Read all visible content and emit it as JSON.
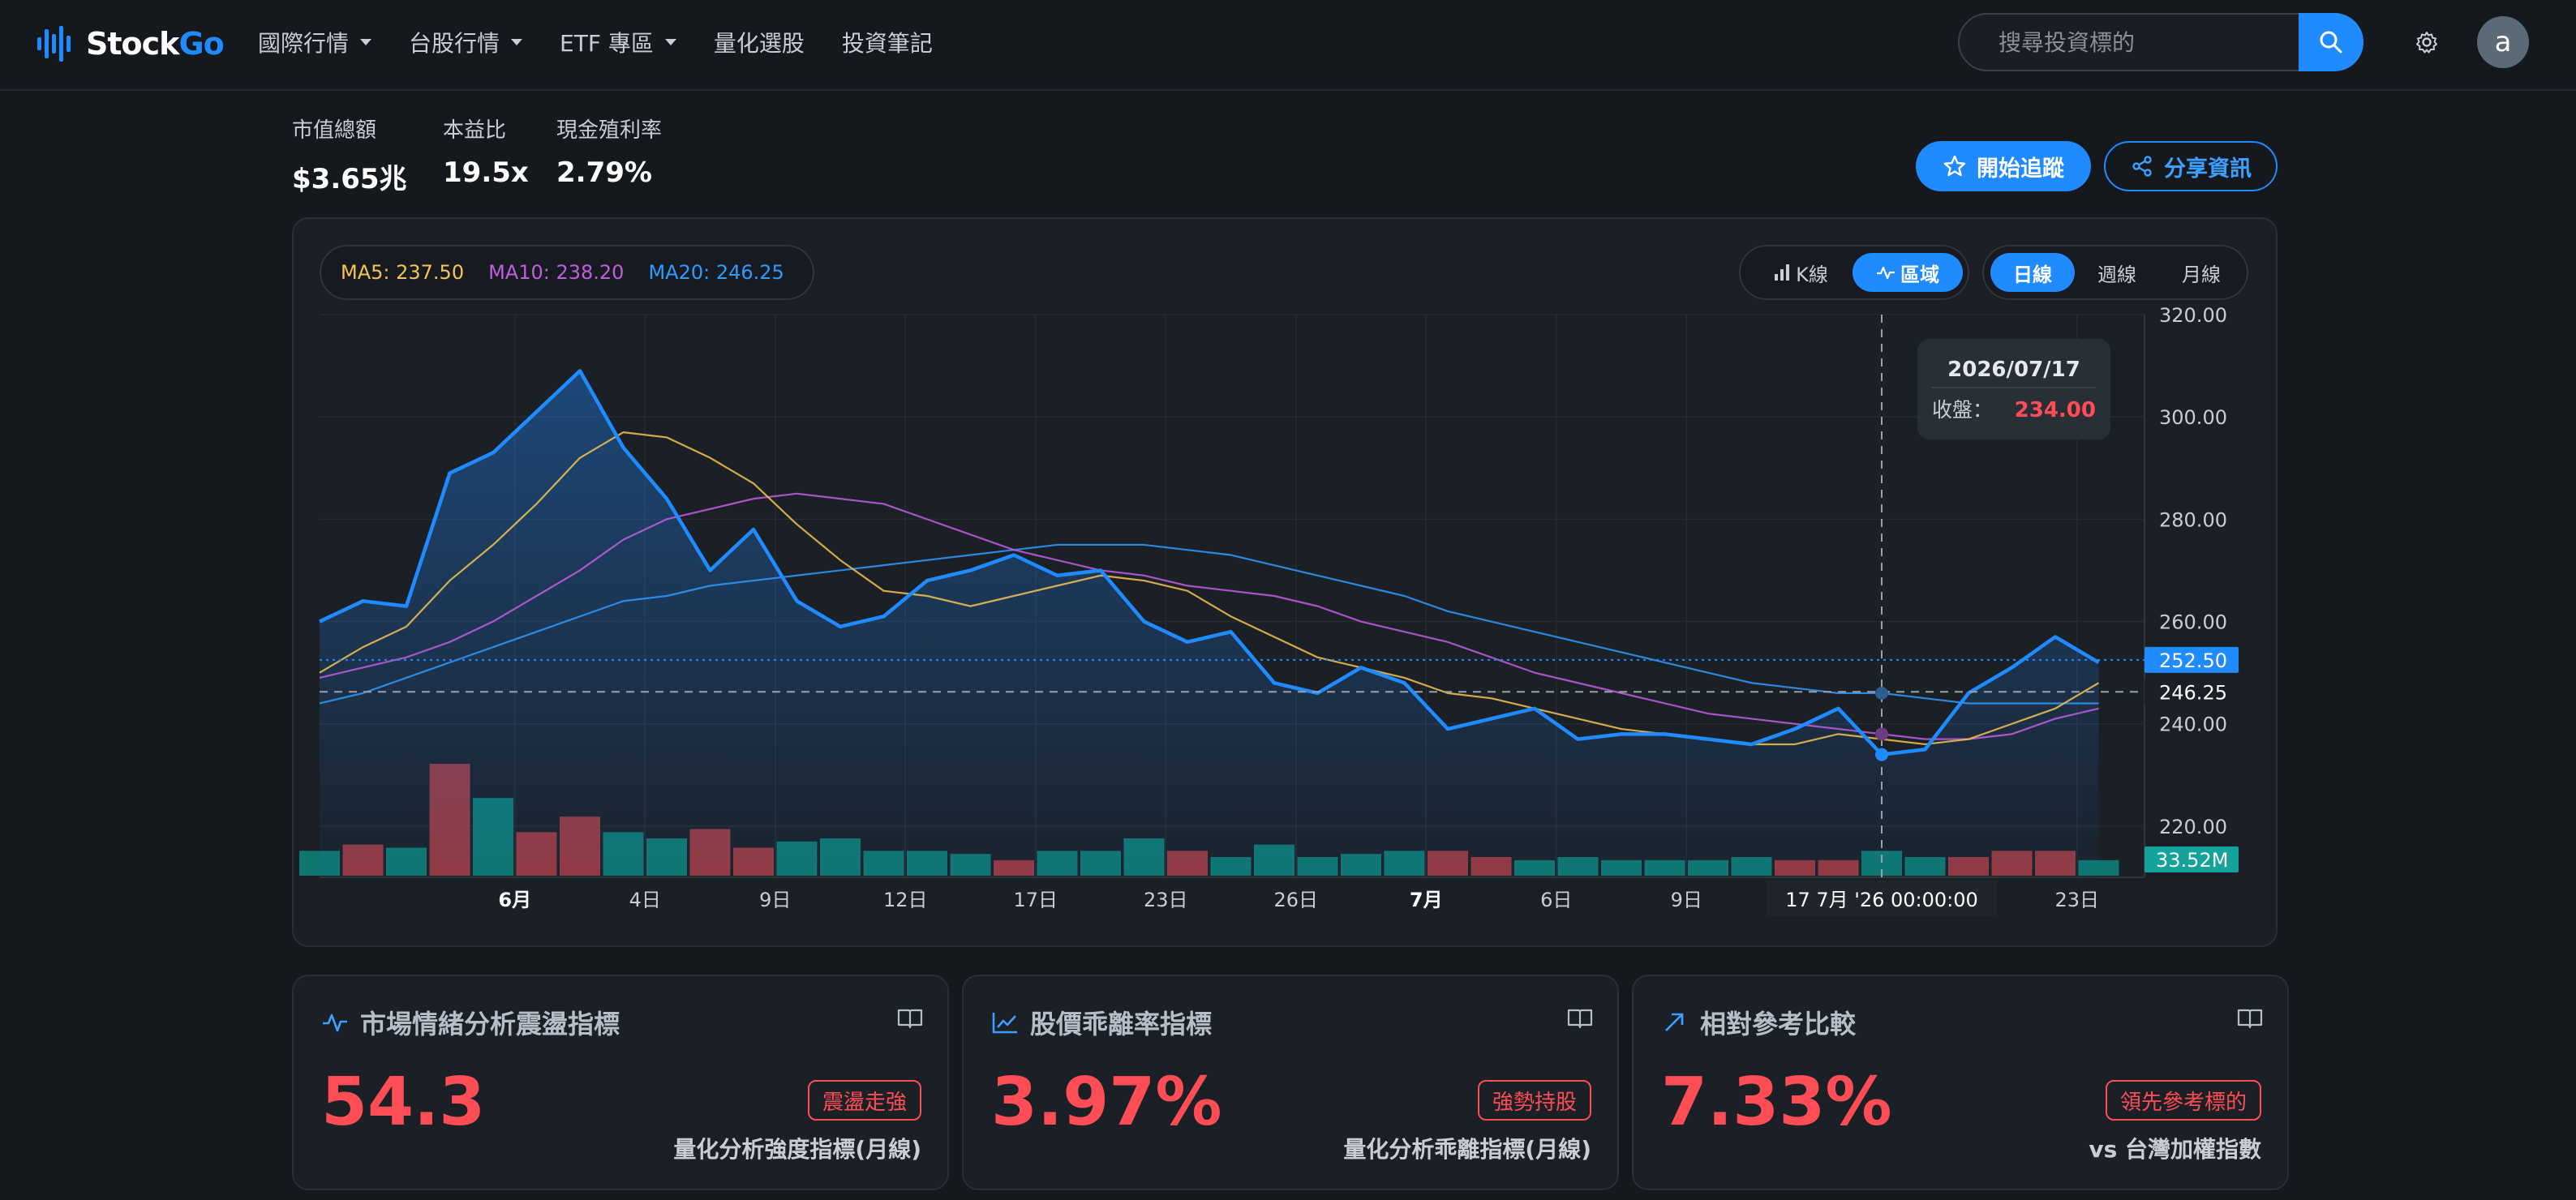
{
  "nav": {
    "logo_text_a": "Stock",
    "logo_text_b": "Go",
    "menu": [
      {
        "label": "國際行情",
        "dropdown": true
      },
      {
        "label": "台股行情",
        "dropdown": true
      },
      {
        "label": "ETF 專區",
        "dropdown": true
      },
      {
        "label": "量化選股",
        "dropdown": false
      },
      {
        "label": "投資筆記",
        "dropdown": false
      }
    ],
    "search_placeholder": "搜尋投資標的",
    "avatar_letter": "a"
  },
  "stats": [
    {
      "label": "市值總額",
      "value": "$3.65兆"
    },
    {
      "label": "本益比",
      "value": "19.5x"
    },
    {
      "label": "現金殖利率",
      "value": "2.79%"
    }
  ],
  "actions": {
    "follow": "開始追蹤",
    "share": "分享資訊"
  },
  "ma_legend": [
    {
      "label": "MA5: 237.50",
      "color": "#f5c451"
    },
    {
      "label": "MA10: 238.20",
      "color": "#c15ee0"
    },
    {
      "label": "MA20: 246.25",
      "color": "#2e9bff"
    }
  ],
  "chart_modes": [
    {
      "label": "K線",
      "active": false
    },
    {
      "label": "區域",
      "active": true
    }
  ],
  "periods": [
    {
      "label": "日線",
      "active": true
    },
    {
      "label": "週線",
      "active": false
    },
    {
      "label": "月線",
      "active": false
    }
  ],
  "colors": {
    "accent": "#1f8bff",
    "up": "#ff4d55",
    "ma5": "#f5c451",
    "ma10": "#c15ee0",
    "ma20": "#2e9bff",
    "vol_up": "#9b3a40",
    "vol_down": "#0f7a73"
  },
  "chart_data": {
    "type": "area",
    "y_ticks": [
      "320.00",
      "300.00",
      "280.00",
      "260.00",
      "240.00",
      "220.00"
    ],
    "ylim": [
      210,
      320
    ],
    "x_ticks": [
      {
        "label": "6月",
        "i": 4.5,
        "bold": true
      },
      {
        "label": "4日",
        "i": 7.5
      },
      {
        "label": "9日",
        "i": 10.5
      },
      {
        "label": "12日",
        "i": 13.5
      },
      {
        "label": "17日",
        "i": 16.5
      },
      {
        "label": "23日",
        "i": 19.5
      },
      {
        "label": "26日",
        "i": 22.5
      },
      {
        "label": "7月",
        "i": 25.5,
        "bold": true
      },
      {
        "label": "6日",
        "i": 28.5
      },
      {
        "label": "9日",
        "i": 31.5
      },
      {
        "label": "23日",
        "i": 40.5
      }
    ],
    "crosshair": {
      "index": 36,
      "x_label": "17 7月 '26   00:00:00",
      "y_label": "246.25"
    },
    "tooltip": {
      "date": "2026/07/17",
      "label": "收盤：",
      "value": "234.00"
    },
    "last_price_label": "252.50",
    "last_price": 252.5,
    "volume_label": "33.52M",
    "close": [
      260,
      264,
      263,
      289,
      293,
      301,
      309,
      294,
      284,
      270,
      278,
      264,
      259,
      261,
      268,
      270,
      273,
      269,
      270,
      260,
      256,
      258,
      248,
      246,
      251,
      248,
      239,
      241,
      243,
      237,
      238,
      238,
      237,
      236,
      239,
      243,
      234,
      235,
      246,
      251,
      257,
      252
    ],
    "ma5": [
      250,
      255,
      259,
      268,
      275,
      283,
      292,
      297,
      296,
      292,
      287,
      279,
      272,
      266,
      265,
      263,
      265,
      267,
      269,
      268,
      266,
      261,
      257,
      253,
      251,
      249,
      246,
      245,
      243,
      241,
      239,
      238,
      237,
      236,
      236,
      238,
      237,
      236,
      237,
      240,
      243,
      248
    ],
    "ma10": [
      249,
      251,
      253,
      256,
      260,
      265,
      270,
      276,
      280,
      282,
      284,
      285,
      284,
      283,
      280,
      277,
      274,
      272,
      270,
      269,
      267,
      266,
      265,
      263,
      260,
      258,
      256,
      253,
      250,
      248,
      246,
      244,
      242,
      241,
      240,
      239,
      238,
      237,
      237,
      238,
      241,
      243
    ],
    "ma20": [
      244,
      246,
      249,
      252,
      255,
      258,
      261,
      264,
      265,
      267,
      268,
      269,
      270,
      271,
      272,
      273,
      274,
      275,
      275,
      275,
      274,
      273,
      271,
      269,
      267,
      265,
      262,
      260,
      258,
      256,
      254,
      252,
      250,
      248,
      247,
      246,
      246,
      245,
      244,
      244,
      244,
      244
    ],
    "volume": [
      8,
      10,
      9,
      36,
      25,
      14,
      19,
      14,
      12,
      15,
      9,
      11,
      12,
      8,
      8,
      7,
      5,
      8,
      8,
      12,
      8,
      6,
      10,
      6,
      7,
      8,
      8,
      6,
      5,
      6,
      5,
      5,
      5,
      6,
      5,
      5,
      8,
      6,
      6,
      8,
      8,
      5
    ],
    "volume_up": [
      false,
      true,
      false,
      true,
      false,
      true,
      true,
      false,
      false,
      true,
      true,
      false,
      false,
      false,
      false,
      false,
      true,
      false,
      false,
      false,
      true,
      false,
      false,
      false,
      false,
      false,
      true,
      true,
      false,
      false,
      false,
      false,
      false,
      false,
      true,
      true,
      false,
      false,
      true,
      true,
      true,
      false
    ]
  },
  "cards": [
    {
      "title": "市場情緒分析震盪指標",
      "value": "54.3",
      "badge": "震盪走強",
      "sub": "量化分析強度指標(月線)",
      "icon": "pulse-icon"
    },
    {
      "title": "股價乖離率指標",
      "value": "3.97%",
      "badge": "強勢持股",
      "sub": "量化分析乖離指標(月線)",
      "icon": "line-chart-icon"
    },
    {
      "title": "相對參考比較",
      "value": "7.33%",
      "badge": "領先參考標的",
      "sub": "vs 台灣加權指數",
      "icon": "arrow-up-right-icon"
    }
  ]
}
